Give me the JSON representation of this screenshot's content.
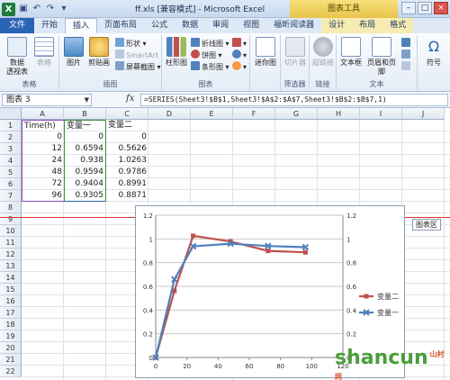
{
  "window": {
    "title": "ff.xls  [兼容模式] - Microsoft Excel",
    "context_tab_group": "图表工具"
  },
  "tabs": [
    "文件",
    "开始",
    "插入",
    "页面布局",
    "公式",
    "数据",
    "审阅",
    "视图",
    "福昕阅读器",
    "设计",
    "布局",
    "格式"
  ],
  "active_tab": "插入",
  "ribbon": {
    "groups": {
      "tables": {
        "label": "表格",
        "pivot": "数据\n透视表",
        "table": "表格"
      },
      "illustrations": {
        "label": "插图",
        "picture": "图片",
        "clipart": "剪贴画",
        "shapes": "形状",
        "smartart": "SmartArt",
        "screenshot": "屏幕截图"
      },
      "charts": {
        "label": "图表",
        "column": "柱形图",
        "line": "折线图",
        "pie": "饼图",
        "bar": "条形图",
        "area": "面积图",
        "scatter": "散点图",
        "other": "其他图表"
      },
      "sparklines": {
        "label": "",
        "sparkline": "迷你图"
      },
      "filter": {
        "label": "筛选器",
        "slicer": "切片器"
      },
      "links": {
        "label": "链接",
        "hyperlink": "超链接"
      },
      "text": {
        "label": "文本",
        "textbox": "文本框",
        "header_footer": "页眉和页脚"
      },
      "symbols": {
        "label": "",
        "symbol": "符号"
      }
    }
  },
  "formula_bar": {
    "name_box": "图表 3",
    "fx": "fx",
    "formula": "=SERIES(Sheet3!$B$1,Sheet3!$A$2:$A$7,Sheet3!$B$2:$B$7,1)"
  },
  "sheet": {
    "columns": [
      "A",
      "B",
      "C",
      "D",
      "E",
      "F",
      "G",
      "H",
      "I",
      "J"
    ],
    "rows": [
      "1",
      "2",
      "3",
      "4",
      "5",
      "6",
      "7",
      "8",
      "9",
      "10",
      "11",
      "12",
      "13",
      "14",
      "15",
      "16",
      "17",
      "18",
      "19",
      "20",
      "21",
      "22"
    ],
    "data": [
      [
        "Time(h)",
        "变量一",
        "变量二"
      ],
      [
        "0",
        "0",
        "0"
      ],
      [
        "12",
        "0.6594",
        "0.5626"
      ],
      [
        "24",
        "0.938",
        "1.0263"
      ],
      [
        "48",
        "0.9594",
        "0.9786"
      ],
      [
        "72",
        "0.9404",
        "0.8991"
      ],
      [
        "96",
        "0.9305",
        "0.8871"
      ]
    ]
  },
  "chart_tooltip": "图表区",
  "chart_data": {
    "type": "line",
    "x": [
      0,
      12,
      24,
      48,
      72,
      96
    ],
    "series": [
      {
        "name": "变量一",
        "values": [
          0,
          0.6594,
          0.938,
          0.9594,
          0.9404,
          0.9305
        ],
        "color": "#4f81bd"
      },
      {
        "name": "变量二",
        "values": [
          0,
          0.5626,
          1.0263,
          0.9786,
          0.8991,
          0.8871
        ],
        "color": "#c0504d"
      }
    ],
    "xlim": [
      0,
      120
    ],
    "ylim": [
      0,
      1.2
    ],
    "y_ticks": [
      "0",
      "0.2",
      "0.4",
      "0.6",
      "0.8",
      "1",
      "1.2"
    ],
    "x_ticks": [
      "0",
      "20",
      "40",
      "60",
      "80",
      "100",
      "120"
    ],
    "secondary_y_ticks": [
      "0",
      "0.2",
      "0.4",
      "0.6",
      "0.8",
      "1",
      "1.2"
    ],
    "legend": [
      "变量二",
      "变量一"
    ],
    "legend_position": "right",
    "grid": true
  },
  "watermark": {
    "text": "shancun",
    "suffix": "山村网"
  }
}
